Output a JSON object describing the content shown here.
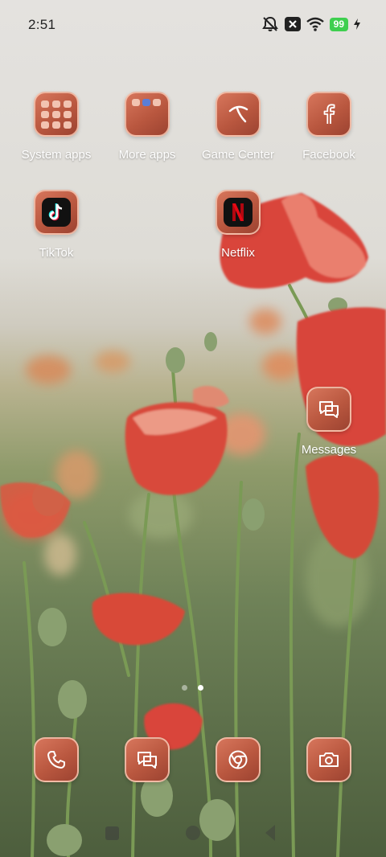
{
  "status_bar": {
    "time": "2:51",
    "battery": "99",
    "icons": [
      "mute-icon",
      "notification-x-icon",
      "wifi-icon",
      "battery-icon",
      "charging-icon"
    ]
  },
  "apps": {
    "system_apps": {
      "label": "System apps",
      "icon": "folder-icon"
    },
    "more_apps": {
      "label": "More apps",
      "icon": "folder-icon"
    },
    "game_center": {
      "label": "Game Center",
      "icon": "game-center-icon"
    },
    "facebook": {
      "label": "Facebook",
      "icon": "facebook-icon"
    },
    "tiktok": {
      "label": "TikTok",
      "icon": "tiktok-icon"
    },
    "netflix": {
      "label": "Netflix",
      "icon": "netflix-icon"
    },
    "messages": {
      "label": "Messages",
      "icon": "messages-icon"
    }
  },
  "dock": [
    "phone-icon",
    "messages-icon",
    "browser-icon",
    "camera-icon"
  ],
  "page_indicator": {
    "pages": 2,
    "current": 2
  },
  "colors": {
    "icon_tile": "#c3604a",
    "icon_glyph": "#ffffff",
    "battery": "#3ecf4f"
  }
}
